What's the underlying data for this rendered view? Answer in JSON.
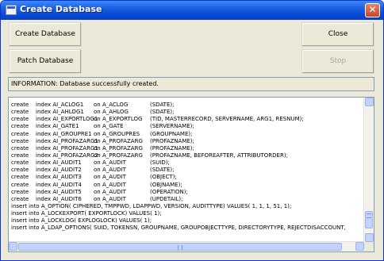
{
  "window": {
    "title": "Create Database",
    "close_symbol": "✕"
  },
  "buttons": {
    "create": "Create Database",
    "close": "Close",
    "patch": "Patch Database",
    "stop": "Stop"
  },
  "info_text": "INFORMATION: Database successfully created.",
  "log": {
    "index_lines": [
      {
        "kw": "create",
        "idx": "index AI_ACLOG1",
        "on": "on A_ACLOG",
        "cols": "(SDATE);"
      },
      {
        "kw": "create",
        "idx": "index AI_AHLOG1",
        "on": "on A_AHLOG",
        "cols": "(SDATE);"
      },
      {
        "kw": "create",
        "idx": "index AI_EXPORTLOG1",
        "on": "on A_EXPORTLOG",
        "cols": "(TID, MASTERRECORD, SERVERNAME, ARG1, RESNUM);"
      },
      {
        "kw": "create",
        "idx": "index AI_GATE1",
        "on": "on A_GATE",
        "cols": "(SERVERNAME);"
      },
      {
        "kw": "create",
        "idx": "index AI_GROUPRE1",
        "on": "on A_GROUPRES",
        "cols": "(GROUPNAME);"
      },
      {
        "kw": "create",
        "idx": "index AI_PROFAZARG1",
        "on": "on A_PROFAZARG",
        "cols": "(PROFAZNAME);"
      },
      {
        "kw": "create",
        "idx": "index AI_PROFAZARG1",
        "on": "on A_PROFAZARG",
        "cols": "(PROFAZNAME);"
      },
      {
        "kw": "create",
        "idx": "index AI_PROFAZARG2",
        "on": "on A_PROFAZARG",
        "cols": "(PROFAZNAME, BEFOREAFTER, ATTRIBUTORDER);"
      },
      {
        "kw": "create",
        "idx": "index AI_AUDIT1",
        "on": "on A_AUDIT",
        "cols": "(SUID);"
      },
      {
        "kw": "create",
        "idx": "index AI_AUDIT2",
        "on": "on A_AUDIT",
        "cols": "(SDATE);"
      },
      {
        "kw": "create",
        "idx": "index AI_AUDIT3",
        "on": "on A_AUDIT",
        "cols": "(OBJECT);"
      },
      {
        "kw": "create",
        "idx": "index AI_AUDIT4",
        "on": "on A_AUDIT",
        "cols": "(OBJNAME);"
      },
      {
        "kw": "create",
        "idx": "index AI_AUDIT5",
        "on": "on A_AUDIT",
        "cols": "(OPERATION);"
      },
      {
        "kw": "create",
        "idx": "index AI_AUDIT6",
        "on": "on A_AUDIT",
        "cols": "(UPDETAIL);"
      }
    ],
    "insert_lines": [
      "insert into A_OPTION( CIPHERED, TMPPWD, LDAPPWD, VERSION, AUDITTYPE) VALUES( 1, 1, 1, 51, 1);",
      "insert into A_LOCKEXPORT( EXPORTLOCK) VALUES( 1);",
      "insert into A_LOCKLOG( EXPLOGLOCK) VALUES( 1);",
      "insert into A_LDAP_OPTIONS(    SUID, TOKENSN, GROUPNAME, GROUPOBJECTTYPE, DIRECTORYTYPE, REJECTDISACCOUNT,"
    ]
  },
  "colors": {
    "titlebar": "#0a4bd6",
    "face": "#ece9d8",
    "scroll_thumb": "#c3d3fd",
    "border": "#7f9db9"
  },
  "icons": [
    "app-icon",
    "close-icon",
    "scroll-up-icon",
    "scroll-down-icon",
    "scroll-left-icon",
    "scroll-right-icon"
  ]
}
